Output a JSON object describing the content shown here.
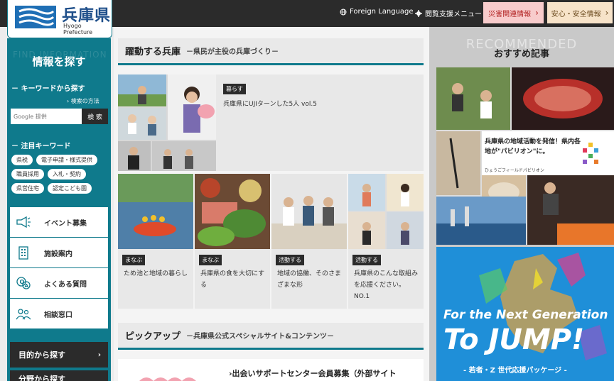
{
  "header": {
    "logo_title": "兵庫県",
    "logo_subtitle": "Hyogo Prefecture",
    "links": [
      {
        "label": "Foreign Language",
        "icon": "globe-icon"
      },
      {
        "label": "閲覧支援メニュー",
        "icon": "gear-icon"
      }
    ],
    "buttons": [
      {
        "label": "災害関連情報",
        "icon": "chevron-right-icon"
      },
      {
        "label": "安心・安全情報",
        "icon": "chevron-right-icon"
      }
    ]
  },
  "sidebar": {
    "ghost_heading": "FIND INFORMATION",
    "title": "情報を探す",
    "keyword_heading": "キーワードから探す",
    "search_help": "検索の方法",
    "search_placeholder": "Google 提供",
    "search_button": "検 索",
    "featured_heading": "注目キーワード",
    "tags": [
      "県税",
      "電子申請・様式提供",
      "職員採用",
      "入札・契約",
      "県営住宅",
      "認定こども園"
    ],
    "menu": [
      {
        "label": "イベント募集",
        "icon": "megaphone-icon"
      },
      {
        "label": "施設案内",
        "icon": "building-icon"
      },
      {
        "label": "よくある質問",
        "icon": "question-bubbles-icon"
      },
      {
        "label": "相談窓口",
        "icon": "consultation-icon"
      }
    ],
    "purpose_button": "目的から探す",
    "category_button": "分野から探す"
  },
  "main": {
    "section1_title": "躍動する兵庫",
    "section1_subtitle": "－県民が主役の兵庫づくり－",
    "feature": {
      "label": "暮らす",
      "text": "兵庫県にUJIターンした5人 vol.5"
    },
    "cards": [
      {
        "label": "まなぶ",
        "text": "ため池と地域の暮らし"
      },
      {
        "label": "まなぶ",
        "text": "兵庫県の食を大切にする"
      },
      {
        "label": "活動する",
        "text": "地域の協働、そのさまざまな形"
      },
      {
        "label": "活動する",
        "text": "兵庫県のこんな取組みを応援ください。NO.1"
      }
    ],
    "section2_title": "ピックアップ",
    "section2_subtitle": "－兵庫県公式スペシャルサイト&コンテンツ－",
    "pickup_text": "›出会いサポートセンター会員募集（外部サイト"
  },
  "right": {
    "ghost_heading": "RECOMMENDED",
    "title": "おすすめ記事",
    "banner1_text": "兵庫県の地域活動を発信！県内各地が\"パビリオン\"に。",
    "banner1_caption": "ひょうごフィールドパビリオン",
    "banner2_line1": "For the Next Generation",
    "banner2_line2": "To JUMP!",
    "banner2_line3": "- 若者・Z 世代応援パッケージ -"
  },
  "colors": {
    "teal": "#0f7a8c",
    "dark": "#2b2b2b",
    "disaster": "#f8cccc",
    "safety": "#f7e3c9",
    "jump_blue": "#1f8fd8"
  }
}
